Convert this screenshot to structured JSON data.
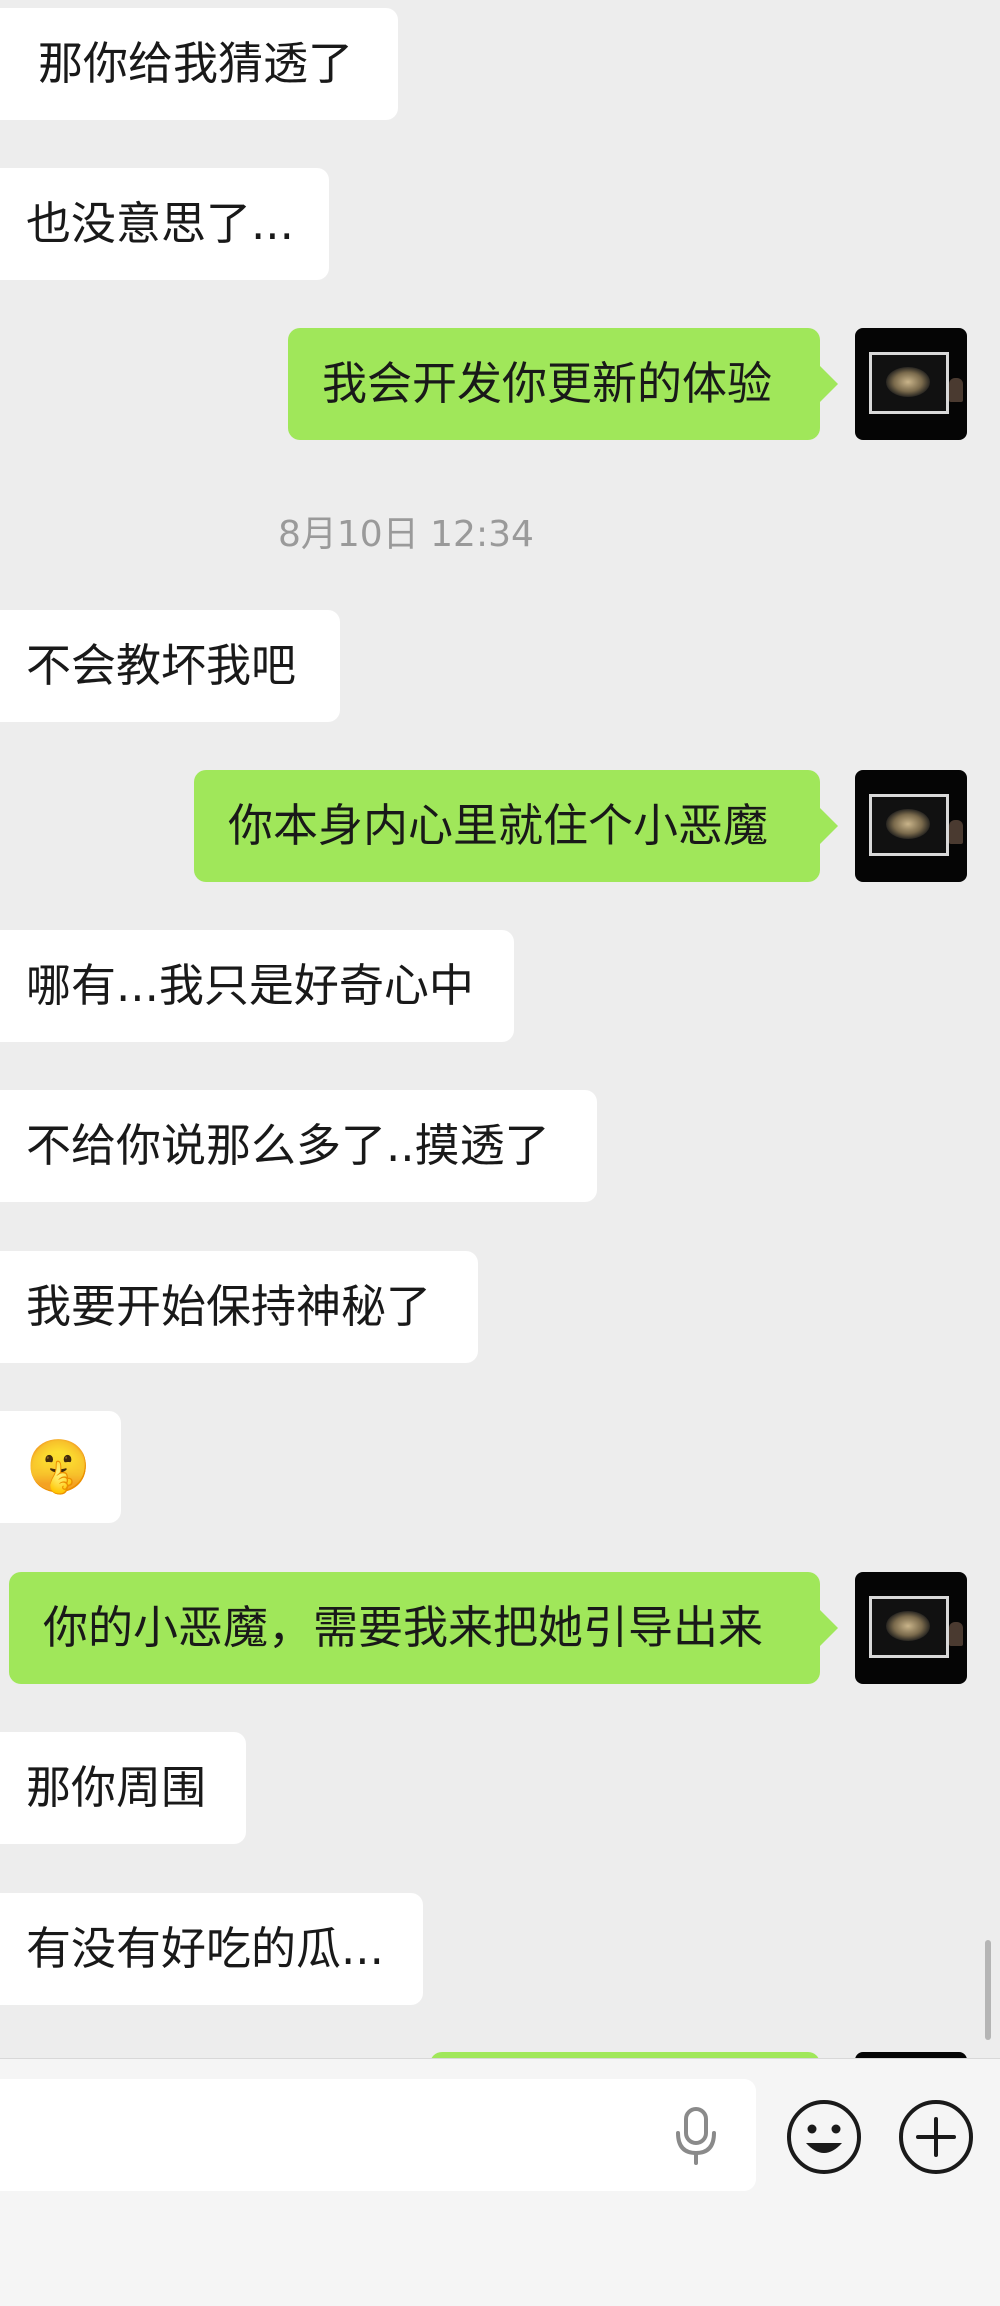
{
  "messages": [
    {
      "side": "recv",
      "text": "那你给我猜透了"
    },
    {
      "side": "recv",
      "text": "也没意思了..."
    },
    {
      "side": "sent",
      "text": "我会开发你更新的体验"
    },
    {
      "side": "time",
      "text": "8月10日 12:34"
    },
    {
      "side": "recv",
      "text": "不会教坏我吧"
    },
    {
      "side": "sent",
      "text": "你本身内心里就住个小恶魔"
    },
    {
      "side": "recv",
      "text": "哪有...我只是好奇心中"
    },
    {
      "side": "recv",
      "text": "不给你说那么多了..摸透了"
    },
    {
      "side": "recv",
      "text": "我要开始保持神秘了"
    },
    {
      "side": "recv",
      "text": "🤫"
    },
    {
      "side": "sent",
      "text": "你的小恶魔，需要我来把她引导出来"
    },
    {
      "side": "recv",
      "text": "那你周围"
    },
    {
      "side": "recv",
      "text": "有没有好吃的瓜..."
    }
  ],
  "composer": {
    "input_value": "",
    "voice_icon": "microphone-icon",
    "emoji_icon": "smiley-icon",
    "more_icon": "plus-circle-icon"
  },
  "colors": {
    "background": "#ededed",
    "received_bubble": "#ffffff",
    "sent_bubble": "#a0e75a",
    "timestamp": "#9a9a9a"
  }
}
